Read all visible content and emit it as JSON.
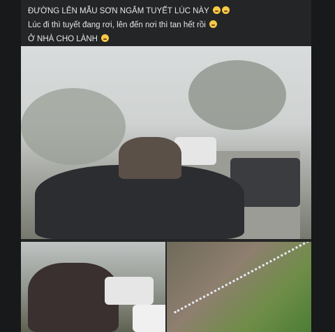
{
  "caption": {
    "line1": "ĐƯỜNG LÊN MẪU SƠN NGẮM TUYẾT LÚC NÀY",
    "line2": "Lúc đi thì tuyết đang rơi, lên đến nơi thì tan hết rồi",
    "line3": "Ở NHÀ CHO LÀNH"
  },
  "icons": {
    "emoji_laugh": "laughing-emoji-icon",
    "emoji_grin": "grinning-emoji-icon",
    "emoji_flushed": "flushed-emoji-icon"
  }
}
